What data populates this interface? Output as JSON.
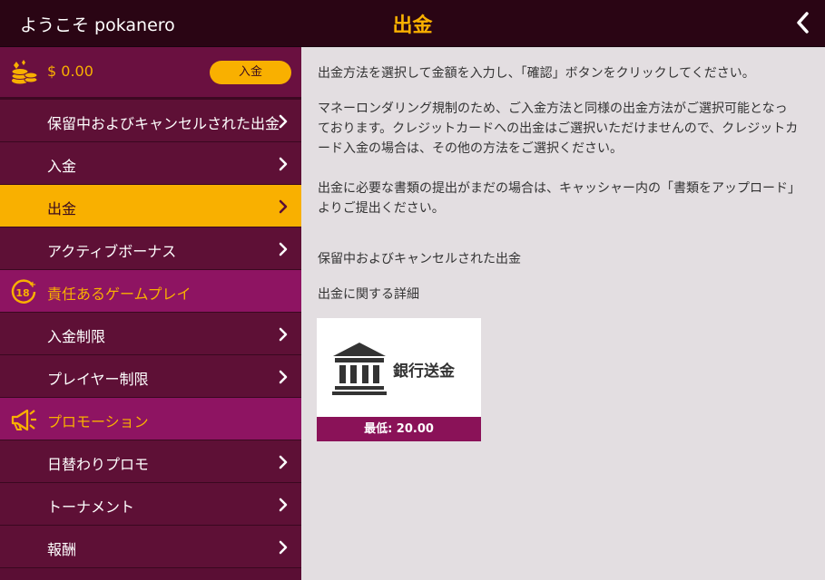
{
  "header": {
    "welcome": "ようこそ pokanero",
    "title": "出金",
    "back_icon": "chevron-left-icon"
  },
  "colors": {
    "accent": "#f9b000",
    "brand": "#5a0e34",
    "section": "#8e1462"
  },
  "sidebar": {
    "balance": "$ 0.00",
    "deposit_button": "入金",
    "items": [
      {
        "label": "保留中およびキャンセルされた出金"
      },
      {
        "label": "入金"
      },
      {
        "label": "出金",
        "active": true
      },
      {
        "label": "アクティブボーナス"
      }
    ],
    "section_responsible": "責任あるゲームプレイ",
    "responsible_items": [
      {
        "label": "入金制限"
      },
      {
        "label": "プレイヤー制限"
      }
    ],
    "section_promotions": "プロモーション",
    "promotion_items": [
      {
        "label": "日替わりプロモ"
      },
      {
        "label": "トーナメント"
      },
      {
        "label": "報酬"
      }
    ]
  },
  "main": {
    "intro": "出金方法を選択して金額を入力し、「確認」ボタンをクリックしてください。",
    "aml_notice": "マネーロンダリング規制のため、ご入金方法と同様の出金方法がご選択可能となっております。クレジットカードへの出金はご選択いただけませんので、クレジットカード入金の場合は、その他の方法をご選択ください。",
    "docs_notice": "出金に必要な書類の提出がまだの場合は、キャッシャー内の「書類をアップロード」よりご提出ください。",
    "pending_link": "保留中およびキャンセルされた出金",
    "details_heading": "出金に関する詳細",
    "method": {
      "name": "銀行送金",
      "minimum": "最低: 20.00",
      "icon": "bank-icon"
    }
  }
}
